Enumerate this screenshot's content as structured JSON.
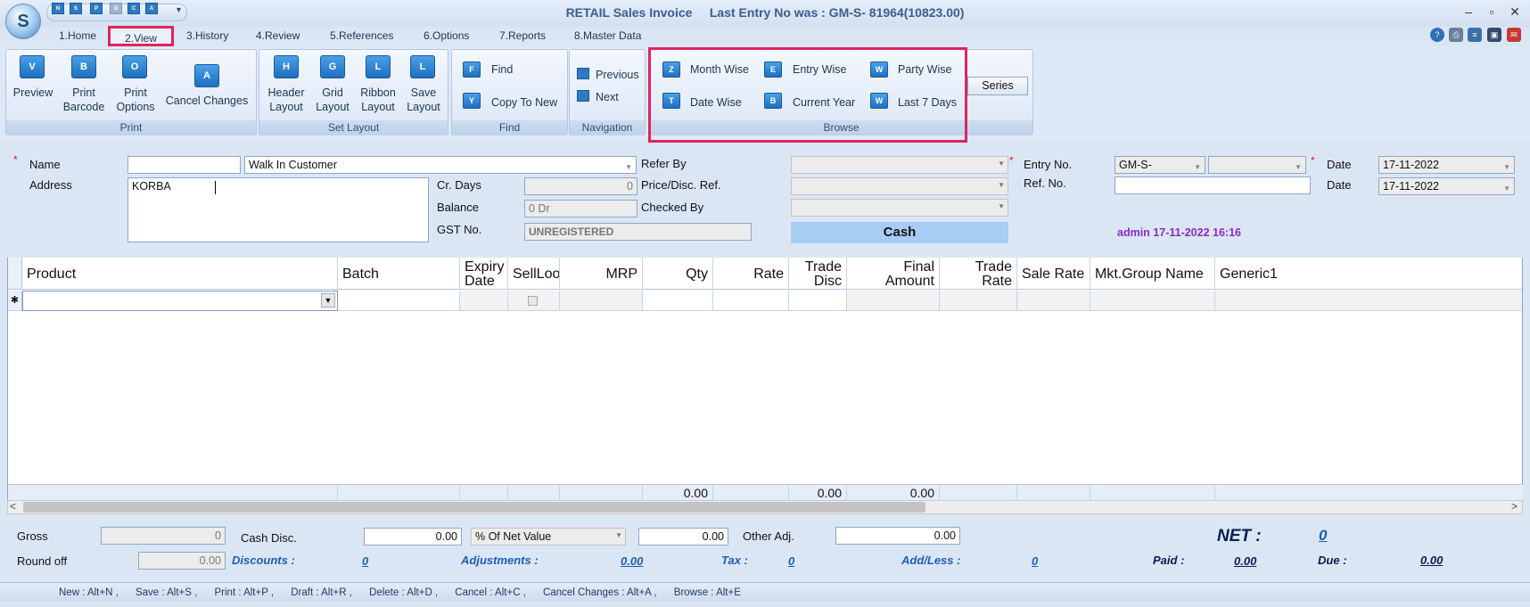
{
  "window": {
    "title": "RETAIL Sales Invoice     Last Entry No was : GM-S- 81964(10823.00)",
    "min": "‒",
    "max": "▫",
    "close": "✕",
    "logo": "S"
  },
  "qat": {
    "b1": "N",
    "b2": "S",
    "b3": "P",
    "b4": "D",
    "b5": "C",
    "b6": "A",
    "dropdown": "▾"
  },
  "tabs": [
    "1.Home",
    "2.View",
    "3.History",
    "4.Review",
    "5.References",
    "6.Options",
    "7.Reports",
    "8.Master Data"
  ],
  "right_icons": [
    "?",
    "⎙",
    "≡",
    "▣",
    "✉"
  ],
  "ribbon": {
    "print": {
      "caption": "Print",
      "items": [
        {
          "label": "Preview",
          "icon": "V"
        },
        {
          "label": "Print\nBarcode",
          "l1": "Print",
          "l2": "Barcode",
          "icon": "B"
        },
        {
          "label": "Print Options",
          "l1": "Print",
          "l2": "Options",
          "icon": "O"
        },
        {
          "label": "Cancel Changes",
          "icon": "A"
        }
      ]
    },
    "set_layout": {
      "caption": "Set Layout",
      "items": [
        {
          "l1": "Header",
          "l2": "Layout",
          "icon": "H"
        },
        {
          "l1": "Grid",
          "l2": "Layout",
          "icon": "G"
        },
        {
          "l1": "Ribbon",
          "l2": "Layout",
          "icon": "L"
        },
        {
          "l1": "Save",
          "l2": "Layout",
          "icon": "L"
        }
      ]
    },
    "find": {
      "caption": "Find",
      "find": "Find",
      "copy": "Copy To New",
      "icon1": "F",
      "icon2": "Y"
    },
    "navigation": {
      "caption": "Navigation",
      "previous": "Previous",
      "next": "Next"
    },
    "browse": {
      "caption": "Browse",
      "month_wise": "Month Wise",
      "entry_wise": "Entry Wise",
      "party_wise": "Party Wise",
      "date_wise": "Date Wise",
      "current_year": "Current Year",
      "last_7_days": "Last 7 Days",
      "i1": "Z",
      "i2": "E",
      "i3": "W",
      "i4": "T",
      "i5": "B",
      "i6": "W"
    },
    "series": "Series"
  },
  "form": {
    "req": "*",
    "name_label": "Name",
    "name_code": "",
    "customer": "Walk In Customer",
    "address_label": "Address",
    "address": "KORBA",
    "cr_days_label": "Cr. Days",
    "cr_days": "0",
    "balance_label": "Balance",
    "balance": "0 Dr",
    "gst_label": "GST No.",
    "gst": "UNREGISTERED",
    "refer_by_label": "Refer By",
    "price_ref_label": "Price/Disc. Ref.",
    "checked_by_label": "Checked By",
    "cash": "Cash",
    "entry_no_label": "Entry No.",
    "entry_prefix": "GM-S-",
    "ref_no_label": "Ref. No.",
    "date_label": "Date",
    "date1": "17-11-2022",
    "date2": "17-11-2022",
    "admin": "admin 17-11-2022 16:16"
  },
  "grid": {
    "columns": [
      "Product",
      "Batch",
      "Expiry Date",
      "SellLoo",
      "MRP",
      "Qty",
      "Rate",
      "Trade Disc",
      "Final Amount",
      "Trade Rate",
      "Sale Rate",
      "Mkt.Group Name",
      "Generic1"
    ],
    "new_row_marker": "✱",
    "totals": {
      "qty": "0.00",
      "trade_disc": "0.00",
      "final_amount": "0.00"
    }
  },
  "scroll": {
    "left": "<",
    "right": ">"
  },
  "bottom": {
    "gross_label": "Gross",
    "gross": "0",
    "round_off_label": "Round off",
    "round_off": "0.00",
    "cash_disc_label": "Cash Disc.",
    "cash_disc": "0.00",
    "disc_type": "% Of Net Value",
    "disc_amount": "0.00",
    "other_adj_label": "Other Adj.",
    "other_adj": "0.00",
    "net_label": "NET :",
    "net": "0",
    "discounts_label": "Discounts :",
    "discounts": "0",
    "adjustments_label": "Adjustments :",
    "adjustments": "0.00",
    "tax_label": "Tax :",
    "tax": "0",
    "addless_label": "Add/Less :",
    "addless": "0",
    "paid_label": "Paid :",
    "paid": "0.00",
    "due_label": "Due :",
    "due": "0.00"
  },
  "status": "New : Alt+N ,      Save : Alt+S ,      Print : Alt+P ,      Draft : Alt+R ,      Delete : Alt+D ,      Cancel : Alt+C ,      Cancel Changes : Alt+A ,      Browse : Alt+E"
}
